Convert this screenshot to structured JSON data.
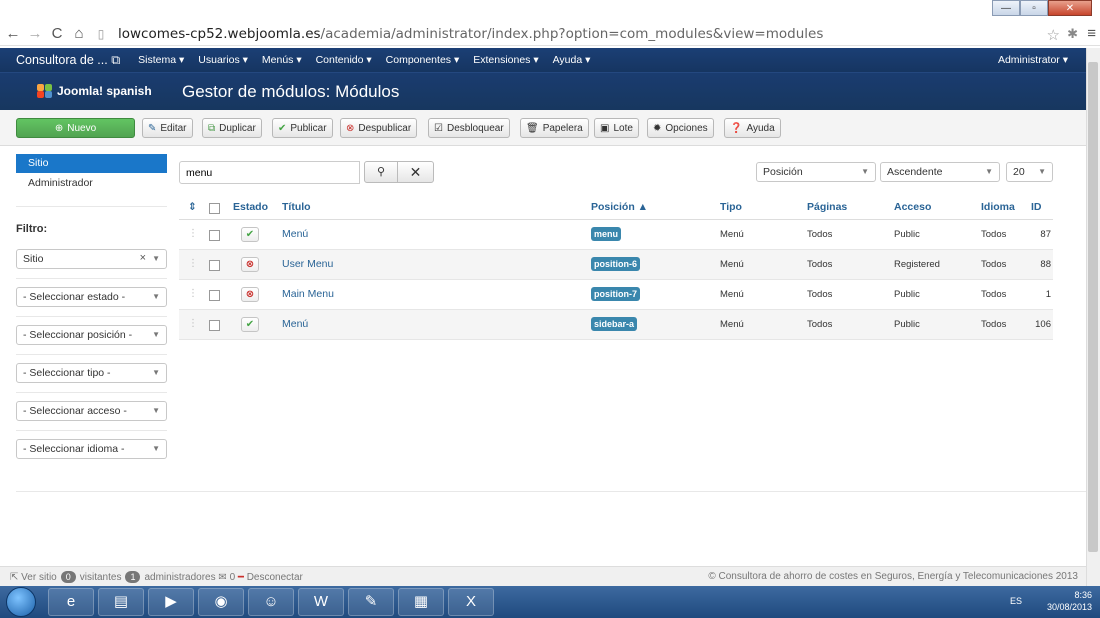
{
  "browser": {
    "url_host": "lowcomes-cp52.webjoomla.es",
    "url_path": "/academia/administrator/index.php?option=com_modules&view=modules"
  },
  "navbar": {
    "site_name": "Consultora de ... ",
    "menus": [
      "Sistema ▾",
      "Usuarios ▾",
      "Menús ▾",
      "Contenido ▾",
      "Componentes ▾",
      "Extensiones ▾",
      "Ayuda ▾"
    ],
    "admin": "Administrator ▾"
  },
  "header": {
    "logo_text": "Joomla! spanish",
    "title": "Gestor de módulos: Módulos"
  },
  "toolbar": {
    "new": "Nuevo",
    "edit": "Editar",
    "duplicate": "Duplicar",
    "publish": "Publicar",
    "unpublish": "Despublicar",
    "unlock": "Desbloquear",
    "trash": "Papelera",
    "batch": "Lote",
    "options": "Opciones",
    "help": "Ayuda"
  },
  "sidebar": {
    "client_active": "Sitio",
    "client_other": "Administrador",
    "filter_label": "Filtro:",
    "client_select": "Sitio",
    "state_select": "- Seleccionar estado -",
    "position_select": "- Seleccionar posición -",
    "type_select": "- Seleccionar tipo -",
    "access_select": "- Seleccionar acceso -",
    "language_select": "- Seleccionar idioma -"
  },
  "search": {
    "value": "menu",
    "order_by": "Posición",
    "direction": "Ascendente",
    "limit": "20"
  },
  "table": {
    "headers": {
      "estado": "Estado",
      "titulo": "Título",
      "posicion": "Posición ▲",
      "tipo": "Tipo",
      "paginas": "Páginas",
      "acceso": "Acceso",
      "idioma": "Idioma",
      "id": "ID"
    },
    "rows": [
      {
        "published": true,
        "title": "Menú",
        "position": "menu",
        "type": "Menú",
        "pages": "Todos",
        "access": "Public",
        "language": "Todos",
        "id": "87"
      },
      {
        "published": false,
        "title": "User Menu",
        "position": "position-6",
        "type": "Menú",
        "pages": "Todos",
        "access": "Registered",
        "language": "Todos",
        "id": "88"
      },
      {
        "published": false,
        "title": "Main Menu",
        "position": "position-7",
        "type": "Menú",
        "pages": "Todos",
        "access": "Public",
        "language": "Todos",
        "id": "1"
      },
      {
        "published": true,
        "title": "Menú",
        "position": "sidebar-a",
        "type": "Menú",
        "pages": "Todos",
        "access": "Public",
        "language": "Todos",
        "id": "106"
      }
    ]
  },
  "footer": {
    "view_site": "Ver sitio",
    "visitors_count": "0",
    "visitors_label": "visitantes",
    "admins_count": "1",
    "admins_label": "administradores",
    "messages_count": "0",
    "logout": "Desconectar",
    "copyright": "© Consultora de ahorro de costes en Seguros, Energía y Telecomunicaciones 2013"
  },
  "taskbar": {
    "lang": "ES",
    "time": "8:36",
    "date": "30/08/2013"
  }
}
